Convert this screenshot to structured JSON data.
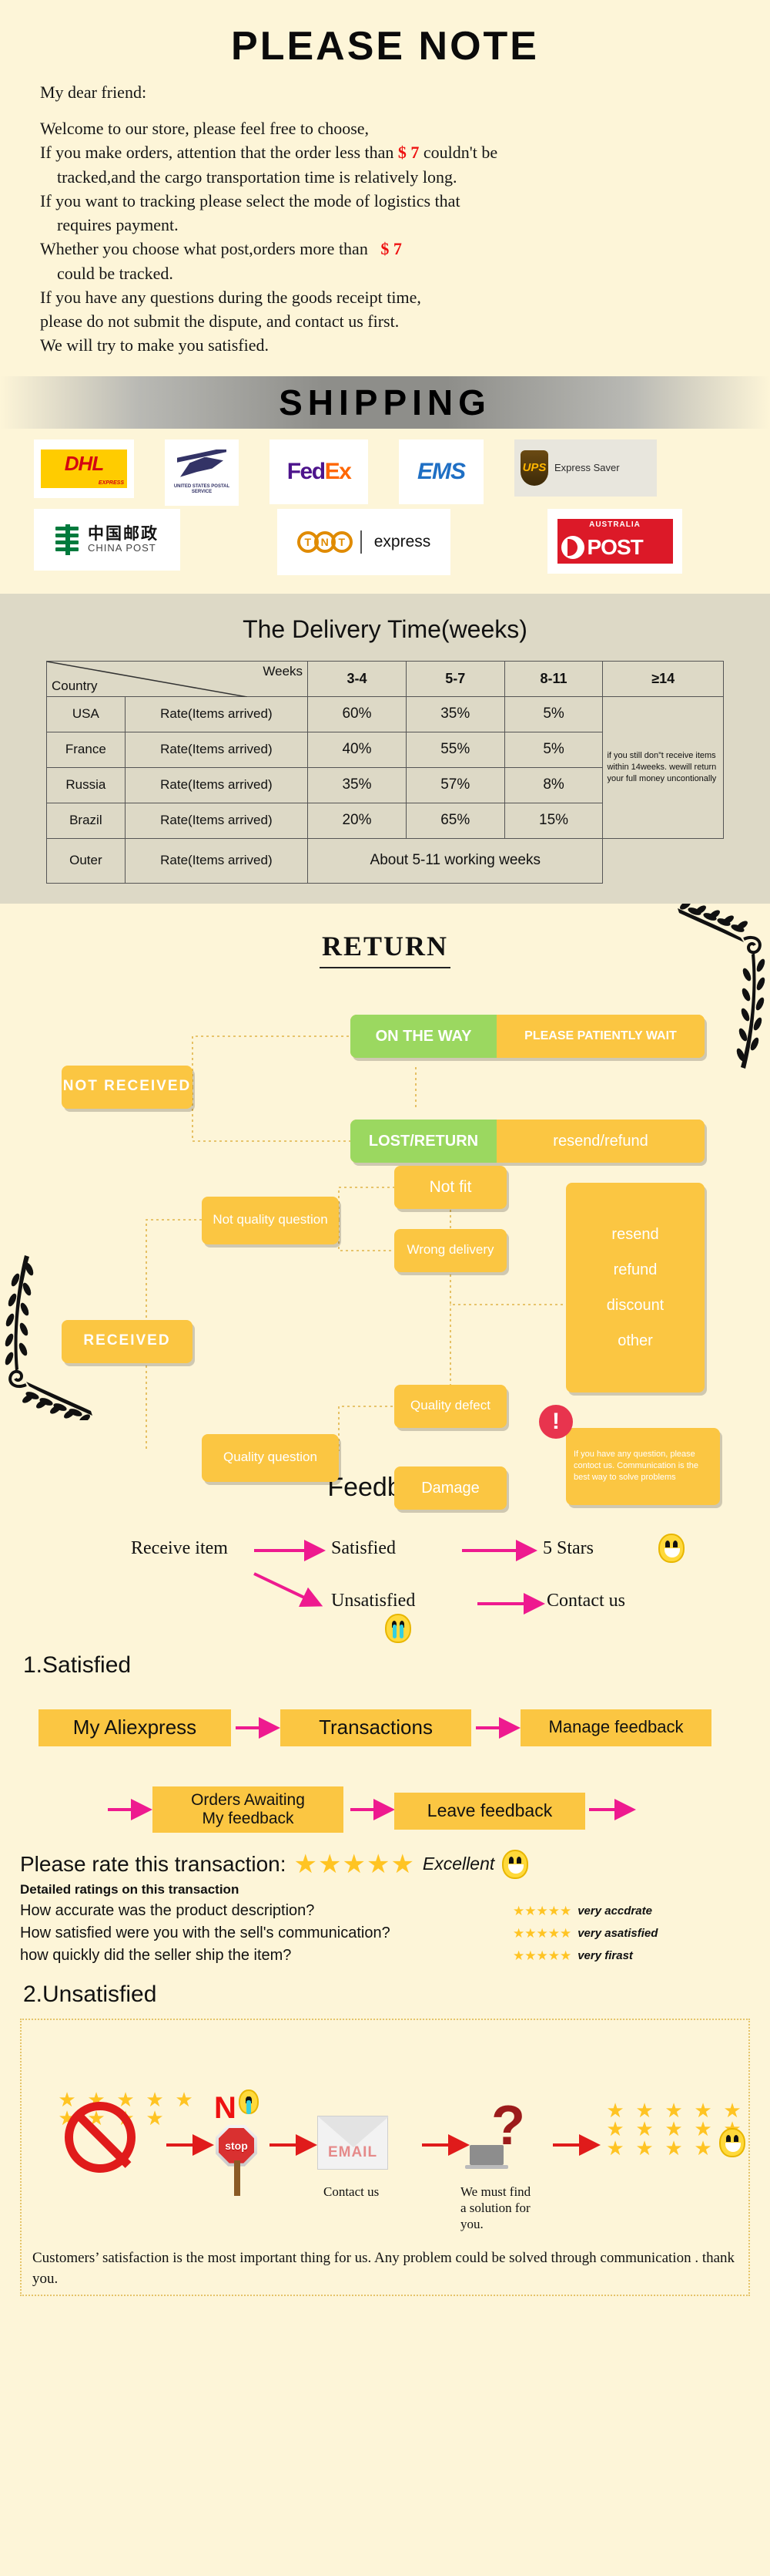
{
  "note": {
    "title": "PLEASE NOTE",
    "greeting": "My dear friend:",
    "lines": [
      "Welcome to our store, please feel free to choose,",
      "If you make orders, attention that the order less than",
      "couldn't be",
      "tracked,and the cargo transportation time is relatively long.",
      "If you want to tracking please select the mode of logistics that",
      "requires payment.",
      "Whether you choose what post,orders more than",
      "could be tracked.",
      "If you have any questions during the goods receipt time,",
      "please do not submit the dispute, and contact us first.",
      "We will try to make you satisfied."
    ],
    "price": "$ 7",
    "price_color": "#ee1111"
  },
  "shipping": {
    "banner_title": "SHIPPING",
    "carriers_row1": [
      {
        "name": "DHL",
        "label": "DHL",
        "sub": "EXPRESS"
      },
      {
        "name": "USPS",
        "label": "UNITED STATES POSTAL SERVICE"
      },
      {
        "name": "FedEx",
        "part1": "Fed",
        "part2": "Ex"
      },
      {
        "name": "EMS",
        "label": "EMS"
      },
      {
        "name": "UPS",
        "label": "UPS",
        "sub": "Express Saver"
      }
    ],
    "carriers_row2": [
      {
        "name": "China Post",
        "cn": "中国邮政",
        "en": "CHINA POST"
      },
      {
        "name": "TNT",
        "letters": [
          "T",
          "N",
          "T"
        ],
        "sub": "express"
      },
      {
        "name": "Australia Post",
        "top": "AUSTRALIA",
        "bottom": "POST"
      }
    ]
  },
  "delivery": {
    "title": "The Delivery Time(weeks)",
    "corner_top": "Weeks",
    "corner_bottom": "Country",
    "week_columns": [
      "3-4",
      "5-7",
      "8-11",
      "≥14"
    ],
    "rows": [
      {
        "country": "USA",
        "rate_label": "Rate(Items arrived)",
        "values": [
          "60%",
          "35%",
          "5%"
        ]
      },
      {
        "country": "France",
        "rate_label": "Rate(Items arrived)",
        "values": [
          "40%",
          "55%",
          "5%"
        ]
      },
      {
        "country": "Russia",
        "rate_label": "Rate(Items arrived)",
        "values": [
          "35%",
          "57%",
          "8%"
        ]
      },
      {
        "country": "Brazil",
        "rate_label": "Rate(Items arrived)",
        "values": [
          "20%",
          "65%",
          "15%"
        ]
      }
    ],
    "outer_row": {
      "country": "Outer",
      "rate_label": "Rate(Items arrived)",
      "value": "About 5-11 working weeks"
    },
    "side_note": "if you still don”t receive items within 14weeks. wewill return your full money uncontionally"
  },
  "return": {
    "title": "RETURN",
    "not_received": "NOT RECEIVED",
    "received": "RECEIVED",
    "on_the_way": "ON THE WAY",
    "on_the_way_action": "PLEASE PATIENTLY WAIT",
    "lost_return": "LOST/RETURN",
    "lost_return_action": "resend/refund",
    "not_quality_question": "Not quality question",
    "quality_question": "Quality question",
    "not_fit": "Not fit",
    "wrong_delivery": "Wrong delivery",
    "quality_defect": "Quality defect",
    "damage": "Damage",
    "outcomes": [
      "resend",
      "refund",
      "discount",
      "other"
    ],
    "warning": "If you have any question, please contoct us. Communication is the best way to solve problems",
    "warning_icon": "exclamation-icon",
    "colors": {
      "yellow": "#fbc642",
      "green": "#9bd860",
      "alert": "#e8344e"
    }
  },
  "feedback": {
    "title": "Feedback",
    "receive_item": "Receive item",
    "satisfied": "Satisfied",
    "five_stars": "5 Stars",
    "unsatisfied": "Unsatisfied",
    "contact_us": "Contact us",
    "arrow_color": "#ee1a8f"
  },
  "satisfied": {
    "heading": "1.Satisfied",
    "steps_row1": [
      "My Aliexpress",
      "Transactions",
      "Manage feedback"
    ],
    "steps_row2": [
      "Orders Awaiting\nMy feedback",
      "Leave feedback"
    ]
  },
  "ratings": {
    "prompt": "Please rate this transaction:",
    "overall_stars": 5,
    "overall_label": "Excellent",
    "subtitle": "Detailed ratings on this transaction",
    "rows": [
      {
        "question": "How accurate was the product description?",
        "stars": 5,
        "tag": "very accdrate"
      },
      {
        "question": "How satisfied were you with the sell's communication?",
        "stars": 5,
        "tag": "very asatisfied"
      },
      {
        "question": "how quickly did the seller ship the item?",
        "stars": 5,
        "tag": "very firast"
      }
    ],
    "star_color": "#ffc423"
  },
  "unsatisfied": {
    "heading": "2.Unsatisfied",
    "no_label": "N",
    "stop_label": "stop",
    "email_label": "EMAIL",
    "caption_contact": "Contact us",
    "caption_solution": "We must find\na solution for\nyou.",
    "footer": "Customers’ satisfaction is the most important thing for us. Any problem could be solved through communication . thank you.",
    "arrow_color": "#e01b1b"
  }
}
